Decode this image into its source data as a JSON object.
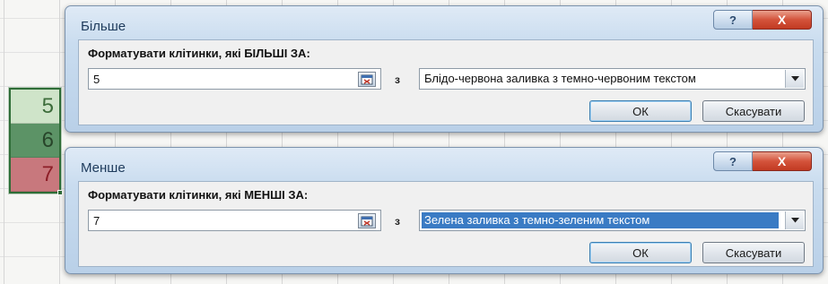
{
  "spreadsheet": {
    "cells": [
      {
        "value": "5"
      },
      {
        "value": "6"
      },
      {
        "value": "7"
      }
    ]
  },
  "dialog_greater": {
    "title": "Більше",
    "help_label": "?",
    "close_label": "X",
    "prompt": "Форматувати клітинки, які БІЛЬШІ ЗА:",
    "value": "5",
    "with_label": "з",
    "format_option": "Блідо-червона заливка з темно-червоним текстом",
    "ok_label": "ОК",
    "cancel_label": "Скасувати"
  },
  "dialog_less": {
    "title": "Менше",
    "help_label": "?",
    "close_label": "X",
    "prompt": "Форматувати клітинки, які МЕНШІ ЗА:",
    "value": "7",
    "with_label": "з",
    "format_option": "Зелена заливка з темно-зеленим текстом",
    "ok_label": "ОК",
    "cancel_label": "Скасувати"
  },
  "colors": {
    "close_button": "#d4533b",
    "selection_highlight": "#3a7bc4",
    "cell_green_light": "#cfe4c9",
    "cell_green_dark": "#5c9366",
    "cell_red": "#c8787d"
  }
}
